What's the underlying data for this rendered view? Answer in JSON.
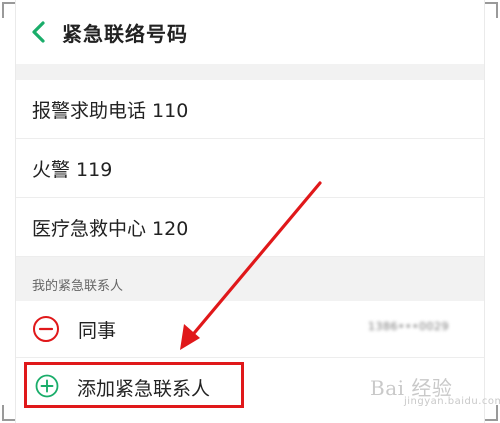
{
  "header": {
    "title": "紧急联络号码"
  },
  "emergency_numbers": [
    {
      "label": "报警求助电话 110"
    },
    {
      "label": "火警 119"
    },
    {
      "label": "医疗急救中心 120"
    }
  ],
  "contacts_section": {
    "header": "我的紧急联系人",
    "contacts": [
      {
        "name": "同事",
        "phone": "1386•••0029"
      }
    ]
  },
  "add_contact": {
    "label": "添加紧急联系人"
  },
  "watermark": {
    "text": "Bai 经验",
    "sub": "jingyan.baidu.com"
  },
  "colors": {
    "accent_green": "#1aad6a",
    "remove_red": "#e0181a",
    "annotation_red": "#e0181a"
  },
  "icons": {
    "back": "chevron-left-icon",
    "remove": "minus-circle-icon",
    "add": "plus-circle-icon"
  }
}
